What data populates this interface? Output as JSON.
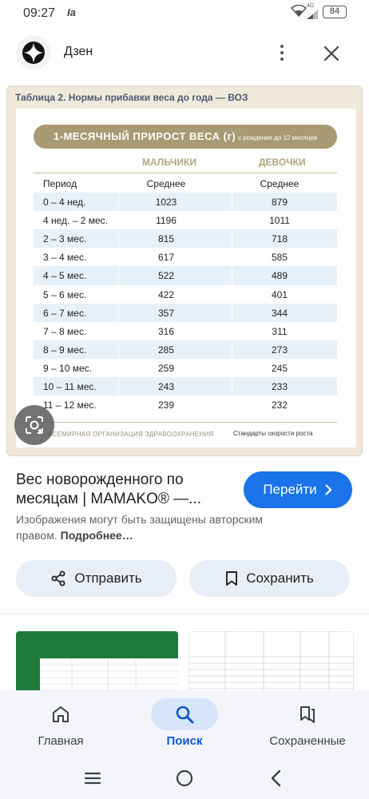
{
  "status_bar": {
    "time": "09:27",
    "sim_label": "Ia",
    "network": "4G",
    "battery": "84"
  },
  "app": {
    "name": "Дзен"
  },
  "image": {
    "title": "Таблица 2. Нормы прибавки веса до года — ВОЗ",
    "banner": "1-МЕСЯЧНЫЙ ПРИРОСТ ВЕСА (г)",
    "banner_sub": "с рождения до 12 месяцев",
    "col_boys": "МАЛЬЧИКИ",
    "col_girls": "ДЕВОЧКИ",
    "rows": [
      {
        "period": "Период",
        "boys": "Среднее",
        "girls": "Среднее"
      },
      {
        "period": "0 – 4 нед.",
        "boys": "1023",
        "girls": "879"
      },
      {
        "period": "4 нед. – 2 мес.",
        "boys": "1196",
        "girls": "1011"
      },
      {
        "period": "2 – 3 мес.",
        "boys": "815",
        "girls": "718"
      },
      {
        "period": "3 – 4 мес.",
        "boys": "617",
        "girls": "585"
      },
      {
        "period": "4 – 5 мес.",
        "boys": "522",
        "girls": "489"
      },
      {
        "period": "5 – 6 мес.",
        "boys": "422",
        "girls": "401"
      },
      {
        "period": "6 – 7 мес.",
        "boys": "357",
        "girls": "344"
      },
      {
        "period": "7 – 8 мес.",
        "boys": "316",
        "girls": "311"
      },
      {
        "period": "8 – 9 мес.",
        "boys": "285",
        "girls": "273"
      },
      {
        "period": "9 – 10 мес.",
        "boys": "259",
        "girls": "245"
      },
      {
        "period": "10 – 11 мес.",
        "boys": "243",
        "girls": "233"
      },
      {
        "period": "11 – 12 мес.",
        "boys": "239",
        "girls": "232"
      }
    ],
    "footer_left": "ВСЕМИРНАЯ ОРГАНИЗАЦИЯ ЗДРАВООХРАНЕНИЯ",
    "footer_right": "Стандарты скорости роста"
  },
  "result": {
    "title": "Вес новорожденного по месяцам | MAMAKO® —...",
    "go_label": "Перейти",
    "copyright": "Изображения могут быть защищены авторским правом.",
    "more_label": "Подробнее…"
  },
  "actions": {
    "share_label": "Отправить",
    "save_label": "Сохранить"
  },
  "bottom_nav": {
    "items": [
      {
        "label": "Главная",
        "icon": "home-icon"
      },
      {
        "label": "Поиск",
        "icon": "search-icon"
      },
      {
        "label": "Сохраненные",
        "icon": "collections-icon"
      }
    ]
  },
  "colors": {
    "accent": "#1a73e8",
    "banner": "#a89a72",
    "row_alt": "#e6f1fa",
    "nav_bg": "#f3f5fb"
  }
}
